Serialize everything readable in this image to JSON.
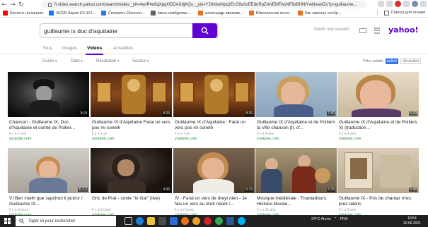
{
  "browser": {
    "url": "fr.video.search.yahoo.com/search/video;_ylt=AwrP4o6qXpgHDDAXdjAQx.;_ylu=Y29sbwNpcjIEcG9zAzEEdnRpZANEMTAxNF8xBHNlYwNwaXZz?p=guillaume...",
    "bookmarks": [
      {
        "label": "Контент на канале",
        "color": "#ff0000"
      },
      {
        "label": "ACER Aspire E3-112...",
        "color": "#0a7cff"
      },
      {
        "label": "Смотреть Discover...",
        "color": "#2c7be5"
      },
      {
        "label": "я́мна камбурова -...",
        "color": "#5f6368"
      },
      {
        "label": "александр ивановк...",
        "color": "#e8711a"
      },
      {
        "label": "Ювенальная юсти...",
        "color": "#e8711a"
      },
      {
        "label": "Как законно отобр...",
        "color": "#e8711a"
      }
    ],
    "bookmarks_list": "Список для чтения"
  },
  "header": {
    "search_value": "guillaume ix duc d'aquitaine",
    "signin": "Ouvrir une session",
    "logo": "yahoo!"
  },
  "tabs": [
    {
      "label": "Tous",
      "active": false
    },
    {
      "label": "Images",
      "active": false
    },
    {
      "label": "Vidéos",
      "active": true
    },
    {
      "label": "Actualités",
      "active": false
    }
  ],
  "filters": {
    "items": [
      "Durée",
      "Date",
      "Résolution",
      "Source"
    ],
    "safe_label": "Filtre adulte",
    "safe_on": "activé",
    "safe_off": "désactivé"
  },
  "videos": [
    {
      "title": "Chanson - Guillaume IX, Duc d'Aquitaine et comte de Poitier...",
      "meta": "Il y a 2 ans",
      "source": "youtube.com",
      "duration": "3:19"
    },
    {
      "title": "Guillaume IX d'Aquitaine Farai un vers pos mi sonelh",
      "meta": "Il y a 1 an",
      "source": "youtube.com",
      "duration": "8:26"
    },
    {
      "title": "Guillaume IX d'Aquitaine : Farai un vers pos mi sonelh",
      "meta": "Il y a 1 an",
      "source": "youtube.com",
      "duration": "8:26"
    },
    {
      "title": "Guillaume IX d'Aquitaine et de Poitiers la VIIe chanson (tr. d'...",
      "meta": "Il y a 4 ans",
      "source": "youtube.com",
      "duration": "7:40"
    },
    {
      "title": "Guillaume IX d'Aquitaine et de Poitiers XI (traduction...",
      "meta": "Il y a 4 ans",
      "source": "youtube.com",
      "duration": "6:39"
    },
    {
      "title": "VI Ben vuelh que sapchon li pulzor / Guillaume IX...",
      "meta": "Il y a 5 jours",
      "source": "youtube.com",
      "duration": "11:12"
    },
    {
      "title": "Gric de Prat - conte \"lo Gat\" (live)",
      "meta": "Il y a 8 mois",
      "source": "youtube.com",
      "duration": "4:36"
    },
    {
      "title": "IV - Farai un vers de dreyt nien - Je fais un vers au droit néant /...",
      "meta": "Il y a 6 jours",
      "source": "youtube.com",
      "duration": "6:23"
    },
    {
      "title": "Musique médiévale : Troubadours. Histoire Musée...",
      "meta": "Il y a 11 ans",
      "source": "youtube.com",
      "duration": "5:33"
    },
    {
      "title": "Guillaume IX - Pos de chantar m'es pres talens",
      "meta": "Il y a 8 ans",
      "source": "youtube.com",
      "duration": "5:48"
    }
  ],
  "taskbar": {
    "search_placeholder": "Taper ici pour rechercher",
    "weather": "24°C  Alerte",
    "lang": "FRA",
    "time": "18:54",
    "date": "20.06.2021"
  }
}
